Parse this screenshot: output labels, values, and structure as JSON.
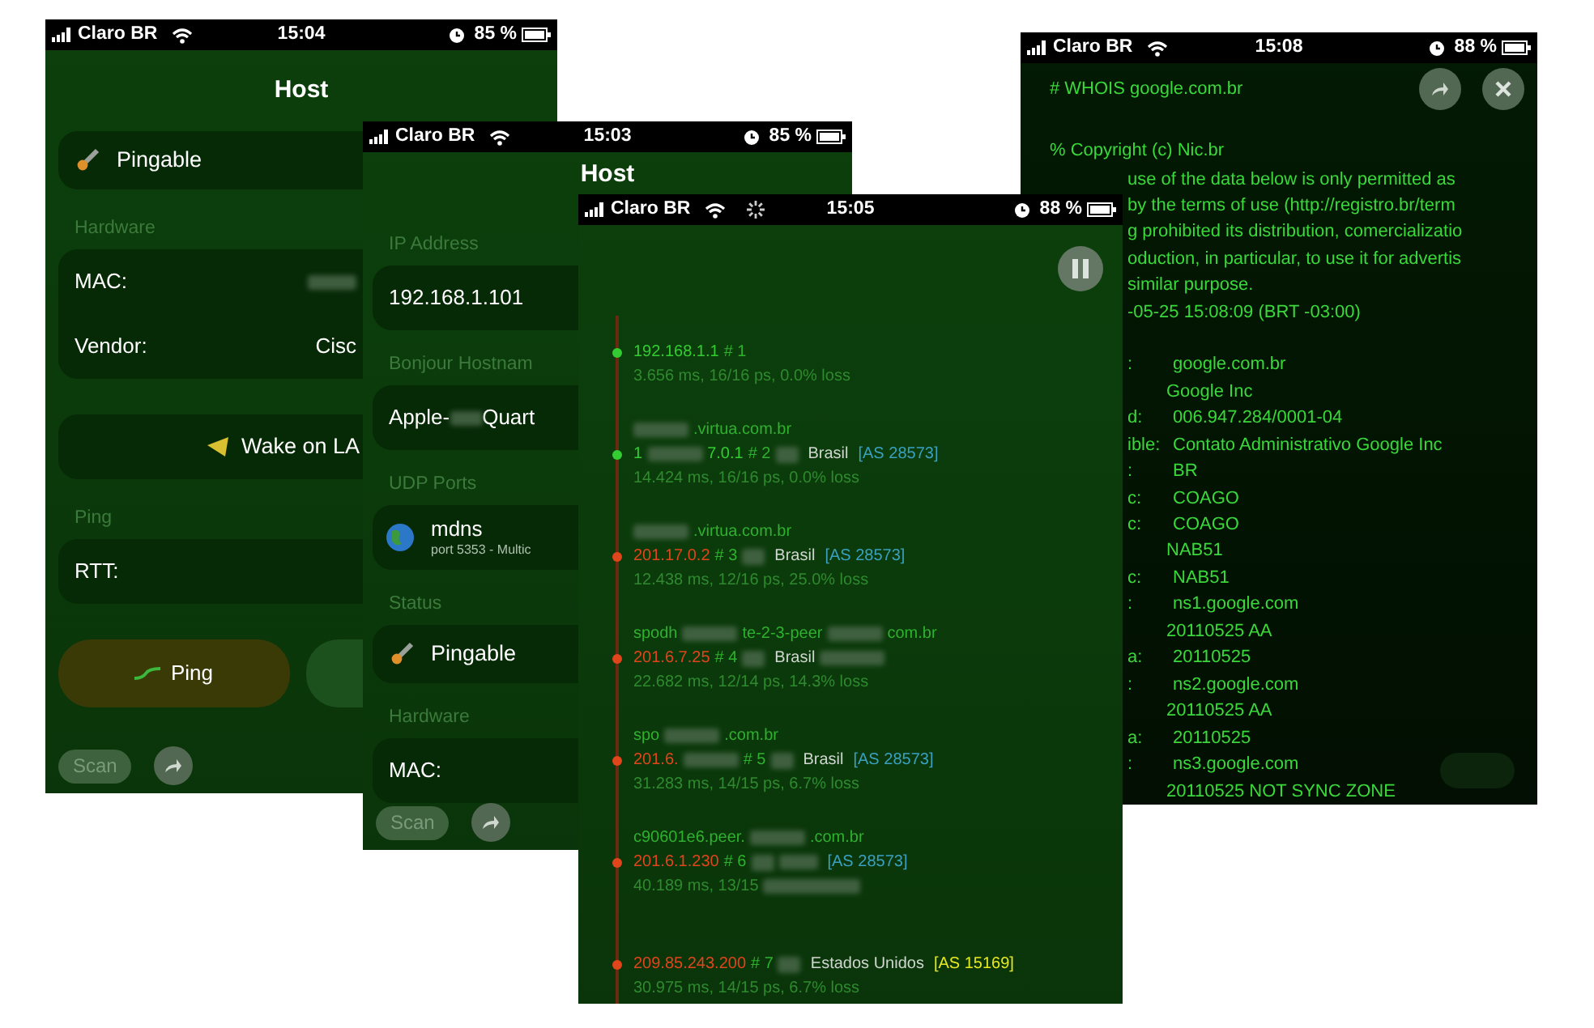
{
  "host_screen": {
    "status_bar": {
      "carrier": "Claro BR",
      "busy": false,
      "time": "15:04",
      "battery": "85 %"
    },
    "title": "Host",
    "blocks": [
      {
        "kind": "status",
        "label": "Pingable"
      },
      {
        "kind": "header",
        "text": "Hardware"
      },
      {
        "kind": "card",
        "rows": [
          {
            "kind": "pair",
            "label": "MAC:",
            "redacted": true
          },
          {
            "kind": "pair",
            "label": "Vendor:",
            "value": "Cisc",
            "redacted": false
          }
        ]
      },
      {
        "kind": "action",
        "label": "Wake on LA"
      },
      {
        "kind": "header",
        "text": "Ping"
      },
      {
        "kind": "card",
        "rows": [
          {
            "kind": "pair",
            "label": "RTT:",
            "redacted": false
          }
        ]
      },
      {
        "kind": "buttons",
        "label": "Ping"
      }
    ],
    "toolbar": {
      "scan": "Scan"
    }
  },
  "details_screen": {
    "status_bar": {
      "carrier": "Claro BR",
      "busy": false,
      "time": "15:03",
      "battery": "85 %"
    },
    "title": "Host",
    "blocks": [
      {
        "kind": "header",
        "text": "IP Address"
      },
      {
        "kind": "card",
        "rows": [
          {
            "kind": "pair",
            "label": "192.168.1.101",
            "redacted": false
          }
        ]
      },
      {
        "kind": "header",
        "text": "Bonjour Hostnam"
      },
      {
        "kind": "card",
        "rows": [
          {
            "kind": "inline",
            "label": "Apple-",
            "redacted": true,
            "value": "Quart"
          }
        ]
      },
      {
        "kind": "header",
        "text": "UDP Ports"
      },
      {
        "kind": "service",
        "title": "mdns",
        "subtitle": "port 5353 - Multic"
      },
      {
        "kind": "header",
        "text": "Status"
      },
      {
        "kind": "status",
        "label": "Pingable"
      },
      {
        "kind": "header",
        "text": "Hardware"
      },
      {
        "kind": "card",
        "rows": [
          {
            "kind": "pair",
            "label": "MAC:",
            "redacted": false
          }
        ]
      }
    ],
    "toolbar": {
      "scan": "Scan"
    }
  },
  "traceroute_screen": {
    "status_bar": {
      "carrier": "Claro BR",
      "busy": true,
      "time": "15:05",
      "battery": "88 %"
    },
    "hops": [
      {
        "ip": [
          {
            "kind": "text",
            "text": "192.168.1.1"
          }
        ],
        "hop": "# 1",
        "flag": false,
        "stats": "3.656 ms, 16/16 ps, 0.0% loss",
        "stats_redacted": false,
        "color": "#33cc33"
      },
      {
        "host": [
          {
            "kind": "blur"
          },
          {
            "kind": "text",
            "text": ".virtua.com.br"
          }
        ],
        "ip": [
          {
            "kind": "text",
            "text": "1"
          },
          {
            "kind": "blur"
          },
          {
            "kind": "text",
            "text": "7.0.1"
          }
        ],
        "hop": "# 2",
        "flag": true,
        "country": "Brasil",
        "as": "[AS 28573]",
        "stats": "14.424 ms, 16/16 ps, 0.0% loss",
        "stats_redacted": false,
        "color": "#33cc33",
        "as_highlight": false
      },
      {
        "host": [
          {
            "kind": "blur"
          },
          {
            "kind": "text",
            "text": ".virtua.com.br"
          }
        ],
        "ip": [
          {
            "kind": "text",
            "text": "201.17.0.2"
          }
        ],
        "hop": "# 3",
        "flag": true,
        "country": "Brasil",
        "as": "[AS 28573]",
        "stats": "12.438 ms, 12/16 ps, 25.0% loss",
        "stats_redacted": false,
        "color": "#e0451c",
        "as_highlight": false
      },
      {
        "host": [
          {
            "kind": "text",
            "text": "spodh"
          },
          {
            "kind": "blur"
          },
          {
            "kind": "text",
            "text": "te-2-3-peer"
          },
          {
            "kind": "blur"
          },
          {
            "kind": "text",
            "text": "com.br"
          }
        ],
        "ip": [
          {
            "kind": "text",
            "text": "201.6.7.25"
          }
        ],
        "hop": "# 4",
        "flag": true,
        "country": "Brasil",
        "as_redacted": true,
        "stats": "22.682 ms, 12/14 ps, 14.3% loss",
        "stats_redacted": false,
        "color": "#e0451c"
      },
      {
        "host": [
          {
            "kind": "text",
            "text": "spo"
          },
          {
            "kind": "blur"
          },
          {
            "kind": "text",
            "text": ".com.br"
          }
        ],
        "ip": [
          {
            "kind": "text",
            "text": "201.6."
          },
          {
            "kind": "blur"
          }
        ],
        "hop": "# 5",
        "flag": true,
        "country": "Brasil",
        "as": "[AS 28573]",
        "stats": "31.283 ms, 14/15 ps, 6.7% loss",
        "stats_redacted": false,
        "color": "#e0451c",
        "as_highlight": false
      },
      {
        "host": [
          {
            "kind": "text",
            "text": "c90601e6.peer."
          },
          {
            "kind": "blur"
          },
          {
            "kind": "text",
            "text": ".com.br"
          }
        ],
        "ip": [
          {
            "kind": "text",
            "text": "201.6.1.230"
          }
        ],
        "hop": "# 6",
        "flag": true,
        "country_redacted": true,
        "as": "[AS 28573]",
        "stats": "40.189 ms, 13/15",
        "stats_redacted": true,
        "color": "#e0451c",
        "as_highlight": false
      },
      {
        "ip": [
          {
            "kind": "text",
            "text": "209.85.243.200"
          }
        ],
        "hop": "# 7",
        "flag": true,
        "country": "Estados Unidos",
        "as": "[AS 15169]",
        "stats": "30.975 ms, 14/15 ps, 6.7% loss",
        "stats_redacted": false,
        "color": "#e0451c",
        "as_highlight": true
      }
    ]
  },
  "whois_screen": {
    "status_bar": {
      "carrier": "Claro BR",
      "busy": false,
      "time": "15:08",
      "battery": "88 %"
    },
    "command": "# WHOIS google.com.br",
    "copyright": "% Copyright (c) Nic.br",
    "notice_lines": [
      "use of the data below is only permitted as",
      "by the terms of use (http://registro.br/term",
      "g prohibited its distribution, comercializatio",
      "oduction, in particular, to use it for advertis",
      "similar purpose.",
      "-05-25 15:08:09 (BRT -03:00)"
    ],
    "fields": [
      {
        "key": ":",
        "value": "google.com.br"
      },
      {
        "value": "Google Inc"
      },
      {
        "key": "d:",
        "value": "006.947.284/0001-04"
      },
      {
        "key": "ible:",
        "value": "Contato Administrativo Google Inc"
      },
      {
        "key": ":",
        "value": "BR"
      },
      {
        "key": "c:",
        "value": "COAGO"
      },
      {
        "key": "c:",
        "value": "COAGO"
      },
      {
        "value": "NAB51"
      },
      {
        "key": "c:",
        "value": "NAB51"
      },
      {
        "key": ":",
        "value": "ns1.google.com"
      },
      {
        "value": "20110525 AA"
      },
      {
        "key": "a:",
        "value": "20110525"
      },
      {
        "key": ":",
        "value": "ns2.google.com"
      },
      {
        "value": "20110525 AA"
      },
      {
        "key": "a:",
        "value": "20110525"
      },
      {
        "key": ":",
        "value": "ns3.google.com"
      },
      {
        "value": "20110525 NOT SYNC ZONE"
      }
    ]
  }
}
